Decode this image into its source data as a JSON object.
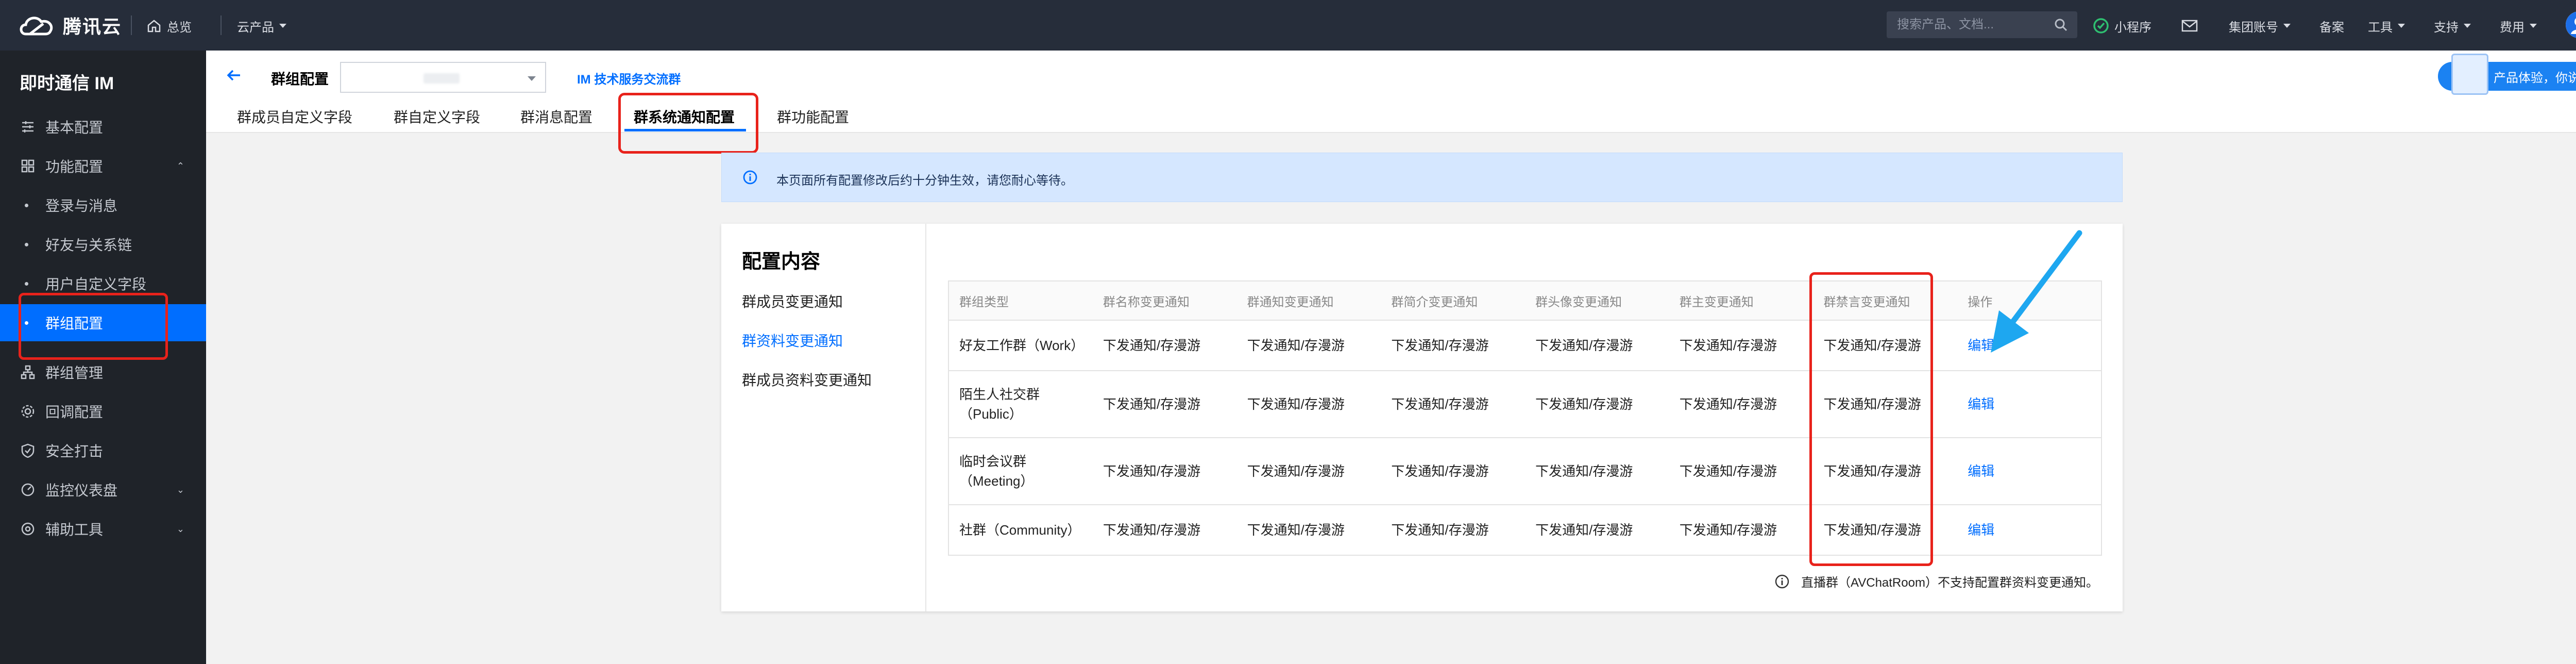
{
  "topbar": {
    "brand": "腾讯云",
    "nav": [
      {
        "label": "总览",
        "icon": "home-icon"
      },
      {
        "label": "云产品",
        "icon": "chevron-down-icon"
      }
    ],
    "search_placeholder": "搜索产品、文档...",
    "right_items": [
      {
        "label": "小程序",
        "icon": "mini-program-icon"
      },
      {
        "label": "",
        "icon": "mail-icon"
      },
      {
        "label": "集团账号",
        "icon": "chevron-down-icon"
      },
      {
        "label": "备案",
        "icon": ""
      },
      {
        "label": "工具",
        "icon": "chevron-down-icon"
      },
      {
        "label": "支持",
        "icon": "chevron-down-icon"
      },
      {
        "label": "费用",
        "icon": "chevron-down-icon"
      }
    ]
  },
  "sidebar": {
    "title": "即时通信 IM",
    "items": [
      {
        "label": "基本配置",
        "icon": "list-icon",
        "type": "top"
      },
      {
        "label": "功能配置",
        "icon": "grid-icon",
        "type": "top",
        "expanded": true
      },
      {
        "label": "登录与消息",
        "type": "sub"
      },
      {
        "label": "好友与关系链",
        "type": "sub"
      },
      {
        "label": "用户自定义字段",
        "type": "sub"
      },
      {
        "label": "群组配置",
        "type": "sub",
        "active": true
      },
      {
        "label": "群组管理",
        "icon": "org-icon",
        "type": "top"
      },
      {
        "label": "回调配置",
        "icon": "settings-icon",
        "type": "top"
      },
      {
        "label": "安全打击",
        "icon": "shield-icon",
        "type": "top"
      },
      {
        "label": "监控仪表盘",
        "icon": "gauge-icon",
        "type": "top",
        "collapsed": true
      },
      {
        "label": "辅助工具",
        "icon": "tool-icon",
        "type": "top",
        "collapsed": true
      }
    ]
  },
  "header": {
    "title": "群组配置",
    "group_link": "IM 技术服务交流群",
    "tabs": [
      "群成员自定义字段",
      "群自定义字段",
      "群消息配置",
      "群系统通知配置",
      "群功能配置"
    ],
    "active_tab": 3,
    "promo": "产品体验，你说了算"
  },
  "notice": {
    "text": "本页面所有配置修改后约十分钟生效，请您耐心等待。"
  },
  "card": {
    "title": "配置内容",
    "nav": [
      "群成员变更通知",
      "群资料变更通知",
      "群成员资料变更通知"
    ],
    "active_nav": 1,
    "columns": [
      "群组类型",
      "群名称变更通知",
      "群通知变更通知",
      "群简介变更通知",
      "群头像变更通知",
      "群主变更通知",
      "群禁言变更通知",
      "操作"
    ],
    "rows": [
      {
        "type": [
          "好友工作群（Work）"
        ],
        "values": [
          "下发通知/存漫游",
          "下发通知/存漫游",
          "下发通知/存漫游",
          "下发通知/存漫游",
          "下发通知/存漫游",
          "下发通知/存漫游"
        ],
        "action": "编辑"
      },
      {
        "type": [
          "陌生人社交群",
          "（Public）"
        ],
        "values": [
          "下发通知/存漫游",
          "下发通知/存漫游",
          "下发通知/存漫游",
          "下发通知/存漫游",
          "下发通知/存漫游",
          "下发通知/存漫游"
        ],
        "action": "编辑"
      },
      {
        "type": [
          "临时会议群",
          "（Meeting）"
        ],
        "values": [
          "下发通知/存漫游",
          "下发通知/存漫游",
          "下发通知/存漫游",
          "下发通知/存漫游",
          "下发通知/存漫游",
          "下发通知/存漫游"
        ],
        "action": "编辑"
      },
      {
        "type": [
          "社群（Community）"
        ],
        "values": [
          "下发通知/存漫游",
          "下发通知/存漫游",
          "下发通知/存漫游",
          "下发通知/存漫游",
          "下发通知/存漫游",
          "下发通知/存漫游"
        ],
        "action": "编辑"
      }
    ],
    "footnote": "直播群（AVChatRoom）不支持配置群资料变更通知。"
  },
  "colors": {
    "topbar": "#262d3a",
    "sidebar": "#1f2329",
    "accent": "#006eff",
    "highlight": "#e8221b",
    "notice_bg": "#d5e7ff",
    "arrow": "#1ea7f0"
  }
}
